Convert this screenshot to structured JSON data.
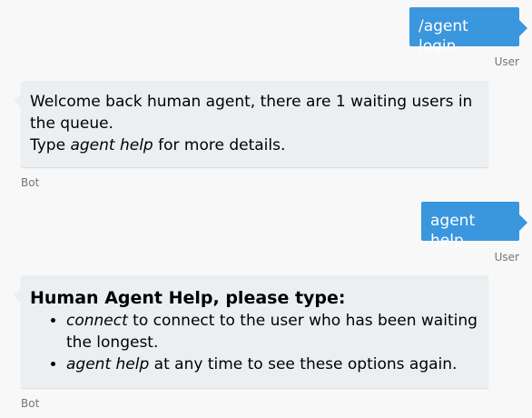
{
  "colors": {
    "background": "#f8f8f8",
    "user_bubble": "#3a96dd",
    "bot_bubble": "#eceff1",
    "sender_label": "#767676"
  },
  "messages": [
    {
      "from": "user",
      "text": "/agent login",
      "sender": "User"
    },
    {
      "from": "bot",
      "line1": "Welcome back human agent, there are 1 waiting users in the queue.",
      "line2_prefix": "Type ",
      "line2_em": "agent help",
      "line2_suffix": " for more details.",
      "sender": "Bot"
    },
    {
      "from": "user",
      "text": "agent help",
      "sender": "User"
    },
    {
      "from": "bot",
      "heading": "Human Agent Help, please type:",
      "items": [
        {
          "em": "connect",
          "text": " to connect to the user who has been waiting the longest."
        },
        {
          "em": "agent help",
          "text": " at any time to see these options again."
        }
      ],
      "sender": "Bot"
    }
  ]
}
